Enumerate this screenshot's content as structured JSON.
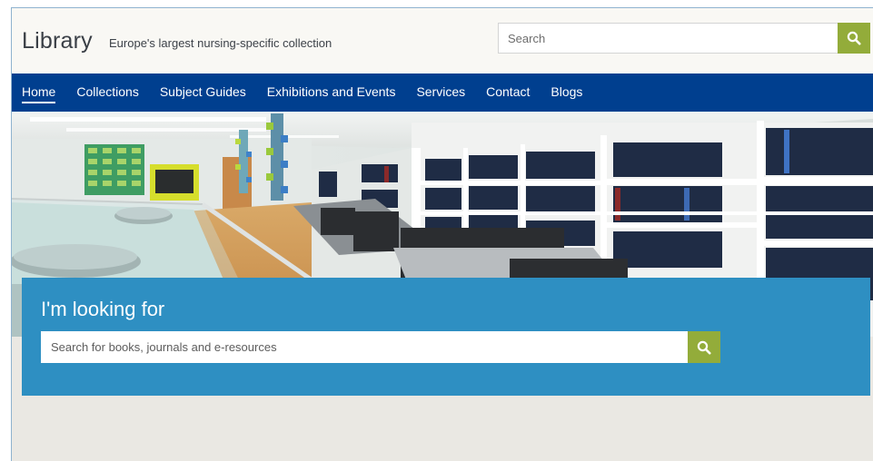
{
  "header": {
    "logo": "Library",
    "tagline": "Europe's largest nursing-specific collection",
    "search": {
      "placeholder": "Search",
      "button_icon": "search-icon"
    }
  },
  "nav": {
    "items": [
      {
        "label": "Home",
        "active": true
      },
      {
        "label": "Collections"
      },
      {
        "label": "Subject Guides"
      },
      {
        "label": "Exhibitions and Events"
      },
      {
        "label": "Services"
      },
      {
        "label": "Contact"
      },
      {
        "label": "Blogs"
      }
    ]
  },
  "finder": {
    "title": "I'm looking for",
    "search": {
      "placeholder": "Search for books, journals and e-resources",
      "button_icon": "search-icon"
    }
  },
  "colors": {
    "nav_bg": "#003f8f",
    "accent_green": "#93ac3a",
    "finder_bg": "#2e8fc2",
    "page_bg": "#eae8e3"
  }
}
